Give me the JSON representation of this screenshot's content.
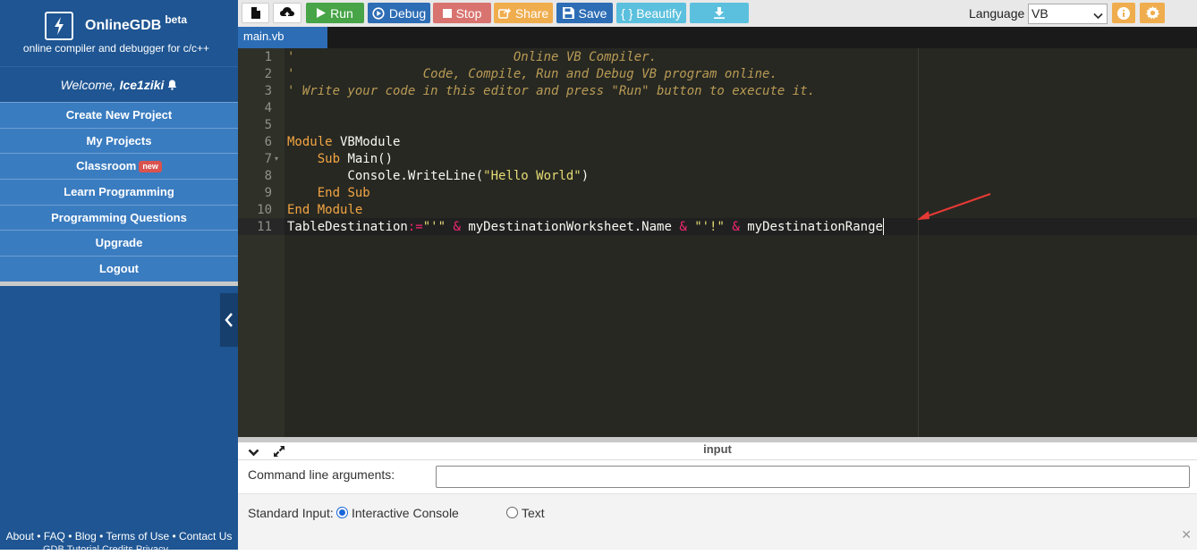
{
  "brand": {
    "name": "OnlineGDB",
    "beta": "beta",
    "tagline": "online compiler and debugger for c/c++"
  },
  "welcome": {
    "prefix": "Welcome,",
    "username": "Ice1ziki"
  },
  "nav": {
    "items": [
      {
        "label": "Create New Project"
      },
      {
        "label": "My Projects"
      },
      {
        "label": "Classroom",
        "badge": "new"
      },
      {
        "label": "Learn Programming"
      },
      {
        "label": "Programming Questions"
      },
      {
        "label": "Upgrade"
      },
      {
        "label": "Logout"
      }
    ]
  },
  "footer": {
    "links": [
      "About",
      "FAQ",
      "Blog",
      "Terms of Use",
      "Contact Us"
    ],
    "separator": "•",
    "cut_text": "GDB Tutorial  Credits  Privacy"
  },
  "toolbar": {
    "run_label": "Run",
    "debug_label": "Debug",
    "stop_label": "Stop",
    "share_label": "Share",
    "save_label": "Save",
    "beautify_label": "{ } Beautify",
    "language_label": "Language",
    "language_value": "VB",
    "colors": {
      "run": "#47a447",
      "debug": "#2d6db5",
      "stop": "#d9736f",
      "share": "#f0ad4e",
      "save": "#2d6db5",
      "beautify": "#5bc0de",
      "download": "#5bc0de",
      "info": "#f0ad4e",
      "settings": "#f0ad4e"
    }
  },
  "tab": {
    "filename": "main.vb"
  },
  "editor": {
    "line_numbers": [
      "1",
      "2",
      "3",
      "4",
      "5",
      "6",
      "7",
      "8",
      "9",
      "10",
      "11"
    ],
    "lines": [
      "'                             Online VB Compiler.",
      "'                 Code, Compile, Run and Debug VB program online.",
      "' Write your code in this editor and press \"Run\" button to execute it.",
      "",
      "",
      "Module VBModule",
      "    Sub Main()",
      "        Console.WriteLine(\"Hello World\")",
      "    End Sub",
      "End Module",
      "TableDestination:=\"'\" & myDestinationWorksheet.Name & \"'!\" & myDestinationRange"
    ]
  },
  "input_panel": {
    "title": "input",
    "cmd_label": "Command line arguments:",
    "cmd_value": "",
    "stdin_label": "Standard Input:",
    "option_interactive": "Interactive Console",
    "option_text": "Text",
    "selected": "Interactive Console"
  },
  "annotation": {
    "arrow_color": "#e53935"
  }
}
